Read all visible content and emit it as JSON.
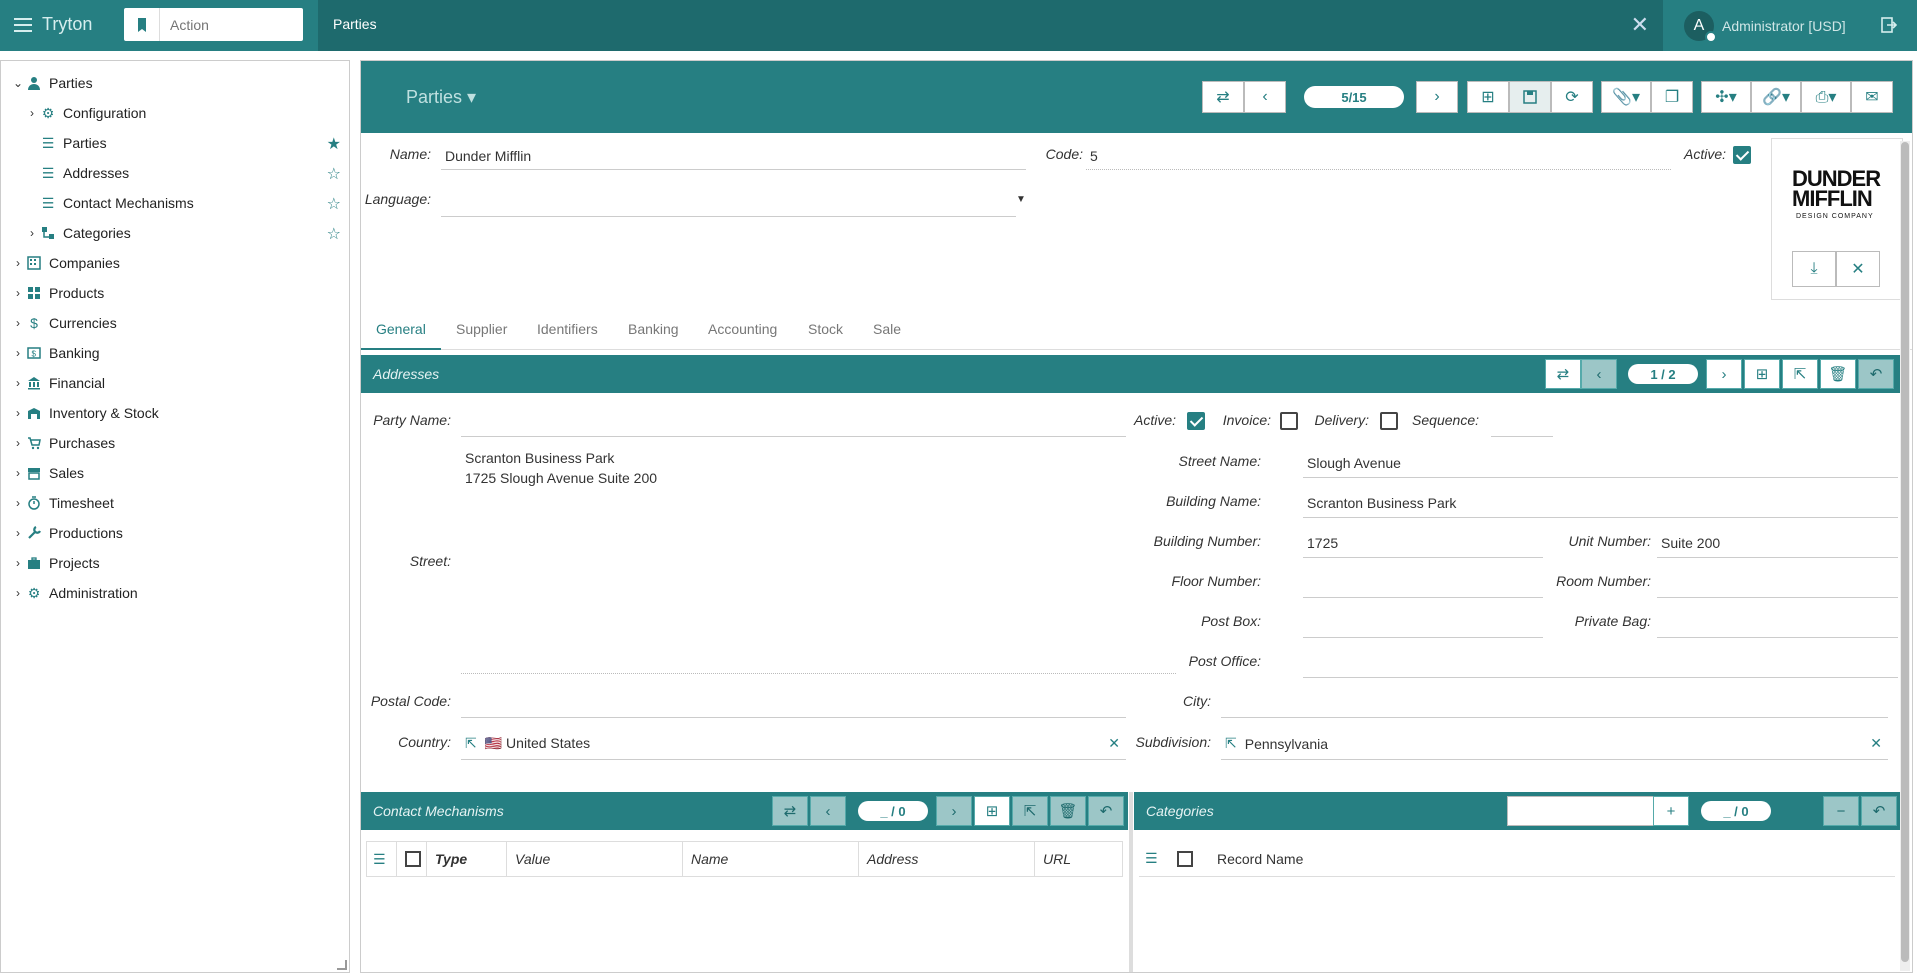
{
  "app": {
    "brand": "Tryton",
    "action_placeholder": "Action",
    "tab_title": "Parties",
    "user": "Administrator [USD]",
    "user_initial": "A"
  },
  "sidebar": {
    "items": [
      {
        "label": "Parties",
        "icon": "person-icon"
      },
      {
        "label": "Configuration",
        "icon": "gear-icon"
      },
      {
        "label": "Parties",
        "icon": "list-icon",
        "starred": true
      },
      {
        "label": "Addresses",
        "icon": "list-icon",
        "starred": false
      },
      {
        "label": "Contact Mechanisms",
        "icon": "list-icon",
        "starred": false
      },
      {
        "label": "Categories",
        "icon": "tree-icon",
        "starred": false
      },
      {
        "label": "Companies",
        "icon": "building-icon"
      },
      {
        "label": "Products",
        "icon": "grid-icon"
      },
      {
        "label": "Currencies",
        "icon": "dollar-icon"
      },
      {
        "label": "Banking",
        "icon": "bank-card-icon"
      },
      {
        "label": "Financial",
        "icon": "bank-icon"
      },
      {
        "label": "Inventory & Stock",
        "icon": "warehouse-icon"
      },
      {
        "label": "Purchases",
        "icon": "cart-icon"
      },
      {
        "label": "Sales",
        "icon": "store-icon"
      },
      {
        "label": "Timesheet",
        "icon": "stopwatch-icon"
      },
      {
        "label": "Productions",
        "icon": "wrench-icon"
      },
      {
        "label": "Projects",
        "icon": "briefcase-icon"
      },
      {
        "label": "Administration",
        "icon": "gear-icon"
      }
    ]
  },
  "form": {
    "title": "Parties",
    "pager": "5/15",
    "name_label": "Name:",
    "name_value": "Dunder Mifflin",
    "code_label": "Code:",
    "code_value": "5",
    "active_label": "Active:",
    "language_label": "Language:",
    "language_value": "",
    "logo_line1": "DUNDER",
    "logo_line2": "MIFFLIN",
    "logo_sub": "DESIGN COMPANY"
  },
  "tabs": [
    "General",
    "Supplier",
    "Identifiers",
    "Banking",
    "Accounting",
    "Stock",
    "Sale"
  ],
  "addresses": {
    "title": "Addresses",
    "pager": "1 / 2",
    "party_name_label": "Party Name:",
    "party_name_value": "",
    "active_label": "Active:",
    "invoice_label": "Invoice:",
    "delivery_label": "Delivery:",
    "sequence_label": "Sequence:",
    "street_label": "Street:",
    "street_value": "Scranton Business Park\n1725 Slough Avenue Suite 200",
    "street_name_label": "Street Name:",
    "street_name_value": "Slough Avenue",
    "building_name_label": "Building Name:",
    "building_name_value": "Scranton Business Park",
    "building_number_label": "Building Number:",
    "building_number_value": "1725",
    "unit_number_label": "Unit Number:",
    "unit_number_value": "Suite 200",
    "floor_number_label": "Floor Number:",
    "room_number_label": "Room Number:",
    "post_box_label": "Post Box:",
    "private_bag_label": "Private Bag:",
    "post_office_label": "Post Office:",
    "postal_code_label": "Postal Code:",
    "city_label": "City:",
    "country_label": "Country:",
    "country_value": "🇺🇸 United States",
    "subdivision_label": "Subdivision:",
    "subdivision_value": "Pennsylvania"
  },
  "contacts": {
    "title": "Contact Mechanisms",
    "pager": "_ / 0",
    "columns": [
      "Type",
      "Value",
      "Name",
      "Address",
      "URL"
    ]
  },
  "categories": {
    "title": "Categories",
    "pager": "_ / 0",
    "columns": [
      "Record Name"
    ]
  },
  "colors": {
    "primary": "#267f82",
    "dark": "#1e6a6d"
  }
}
